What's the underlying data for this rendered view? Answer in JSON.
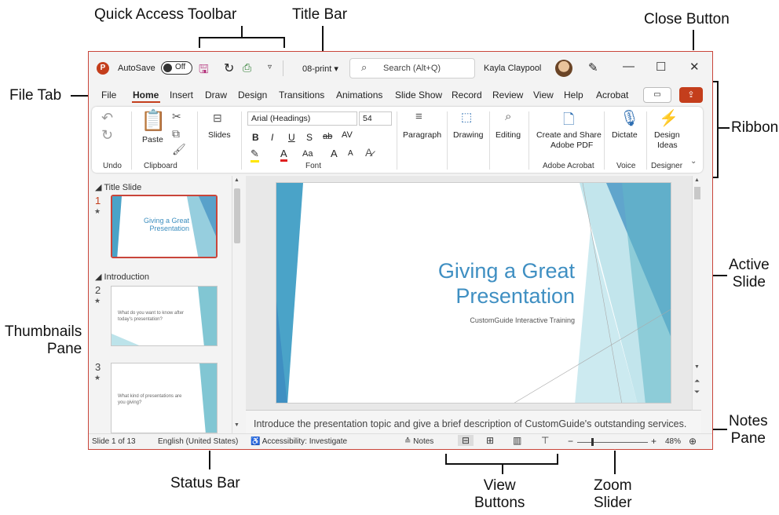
{
  "callouts": {
    "quick_access": "Quick Access Toolbar",
    "title_bar": "Title Bar",
    "close_button": "Close Button",
    "file_tab": "File Tab",
    "ribbon": "Ribbon",
    "active_slide_1": "Active",
    "active_slide_2": "Slide",
    "thumbnails_1": "Thumbnails",
    "thumbnails_2": "Pane",
    "notes_1": "Notes",
    "notes_2": "Pane",
    "status_bar": "Status Bar",
    "view_1": "View",
    "view_2": "Buttons",
    "zoom_1": "Zoom",
    "zoom_2": "Slider"
  },
  "titlebar": {
    "logo": "P",
    "autosave": "AutoSave",
    "toggle_state": "Off",
    "filename": "08-print ▾",
    "search_placeholder": "Search (Alt+Q)",
    "user": "Kayla Claypool",
    "minimize": "—",
    "maximize": "☐",
    "close": "✕"
  },
  "tabs": [
    "File",
    "Home",
    "Insert",
    "Draw",
    "Design",
    "Transitions",
    "Animations",
    "Slide Show",
    "Record",
    "Review",
    "View",
    "Help",
    "Acrobat"
  ],
  "ribbon": {
    "undo_group": "Undo",
    "clipboard_group": "Clipboard",
    "paste": "Paste",
    "slides": "Slides",
    "font_name": "Arial (Headings)",
    "font_size": "54",
    "font_group": "Font",
    "bold": "B",
    "italic": "I",
    "underline": "U",
    "strike": "S",
    "abc": "ab",
    "av": "AV",
    "aa": "Aa",
    "grow": "A",
    "shrink": "A",
    "paragraph": "Paragraph",
    "drawing": "Drawing",
    "editing": "Editing",
    "create_share_1": "Create and Share",
    "create_share_2": "Adobe PDF",
    "acrobat_group": "Adobe Acrobat",
    "dictate": "Dictate",
    "voice_group": "Voice",
    "design_1": "Design",
    "design_2": "Ideas",
    "designer_group": "Designer"
  },
  "thumbnails": {
    "section1": "Title Slide",
    "section2": "Introduction",
    "slide1_title_1": "Giving a Great",
    "slide1_title_2": "Presentation",
    "slide1_num": "1",
    "slide2_num": "2",
    "slide2_text": "What do you want to know after today's presentation?",
    "slide3_num": "3",
    "slide3_text": "What kind of presentations are you giving?"
  },
  "slide": {
    "title_1": "Giving a Great",
    "title_2": "Presentation",
    "subtitle": "CustomGuide Interactive Training"
  },
  "notes": "Introduce the presentation topic and give a brief description of CustomGuide's outstanding services.",
  "status": {
    "slide_count": "Slide 1 of 13",
    "language": "English (United States)",
    "accessibility": "Accessibility: Investigate",
    "notes": "Notes",
    "zoom_minus": "−",
    "zoom_plus": "+",
    "zoom_level": "48%"
  },
  "colors": {
    "accent": "#c43e1c",
    "slide_blue": "#3f8fc2",
    "teal": "#62b8c8"
  }
}
